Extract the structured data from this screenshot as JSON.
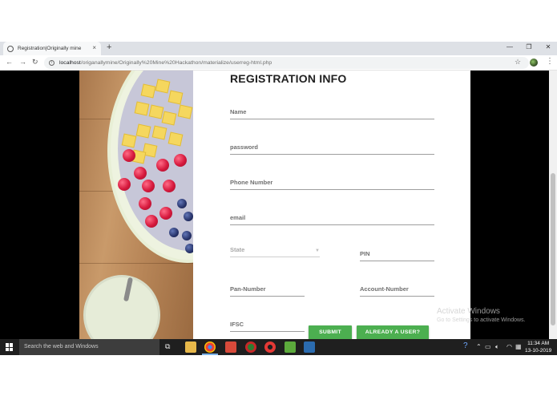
{
  "browser": {
    "tab_title": "Registration|Originally mine",
    "tab_close": "×",
    "new_tab": "+",
    "window_controls": {
      "minimize": "—",
      "maximize": "❐",
      "close": "✕"
    },
    "url_host": "localhost",
    "url_path": "/origanallymine/Originally%20Mine%20Hackathon/materialize/userreg-html.php"
  },
  "form": {
    "title": "REGISTRATION INFO",
    "fields": {
      "name": "Name",
      "password": "password",
      "phone": "Phone Number",
      "email": "email",
      "state": "State",
      "pin": "PIN",
      "pan": "Pan-Number",
      "account": "Account-Number",
      "ifsc": "IFSC"
    },
    "submit_label": "SUBMIT",
    "already_user_label": "ALREADY A USER?"
  },
  "watermark": {
    "title": "Activate Windows",
    "subtitle": "Go to Settings to activate Windows."
  },
  "taskbar": {
    "search_placeholder": "Search the web and Windows",
    "time": "11:34 AM",
    "date": "13-10-2019"
  },
  "colors": {
    "accent_green": "#4caf50",
    "page_background": "#000000"
  }
}
